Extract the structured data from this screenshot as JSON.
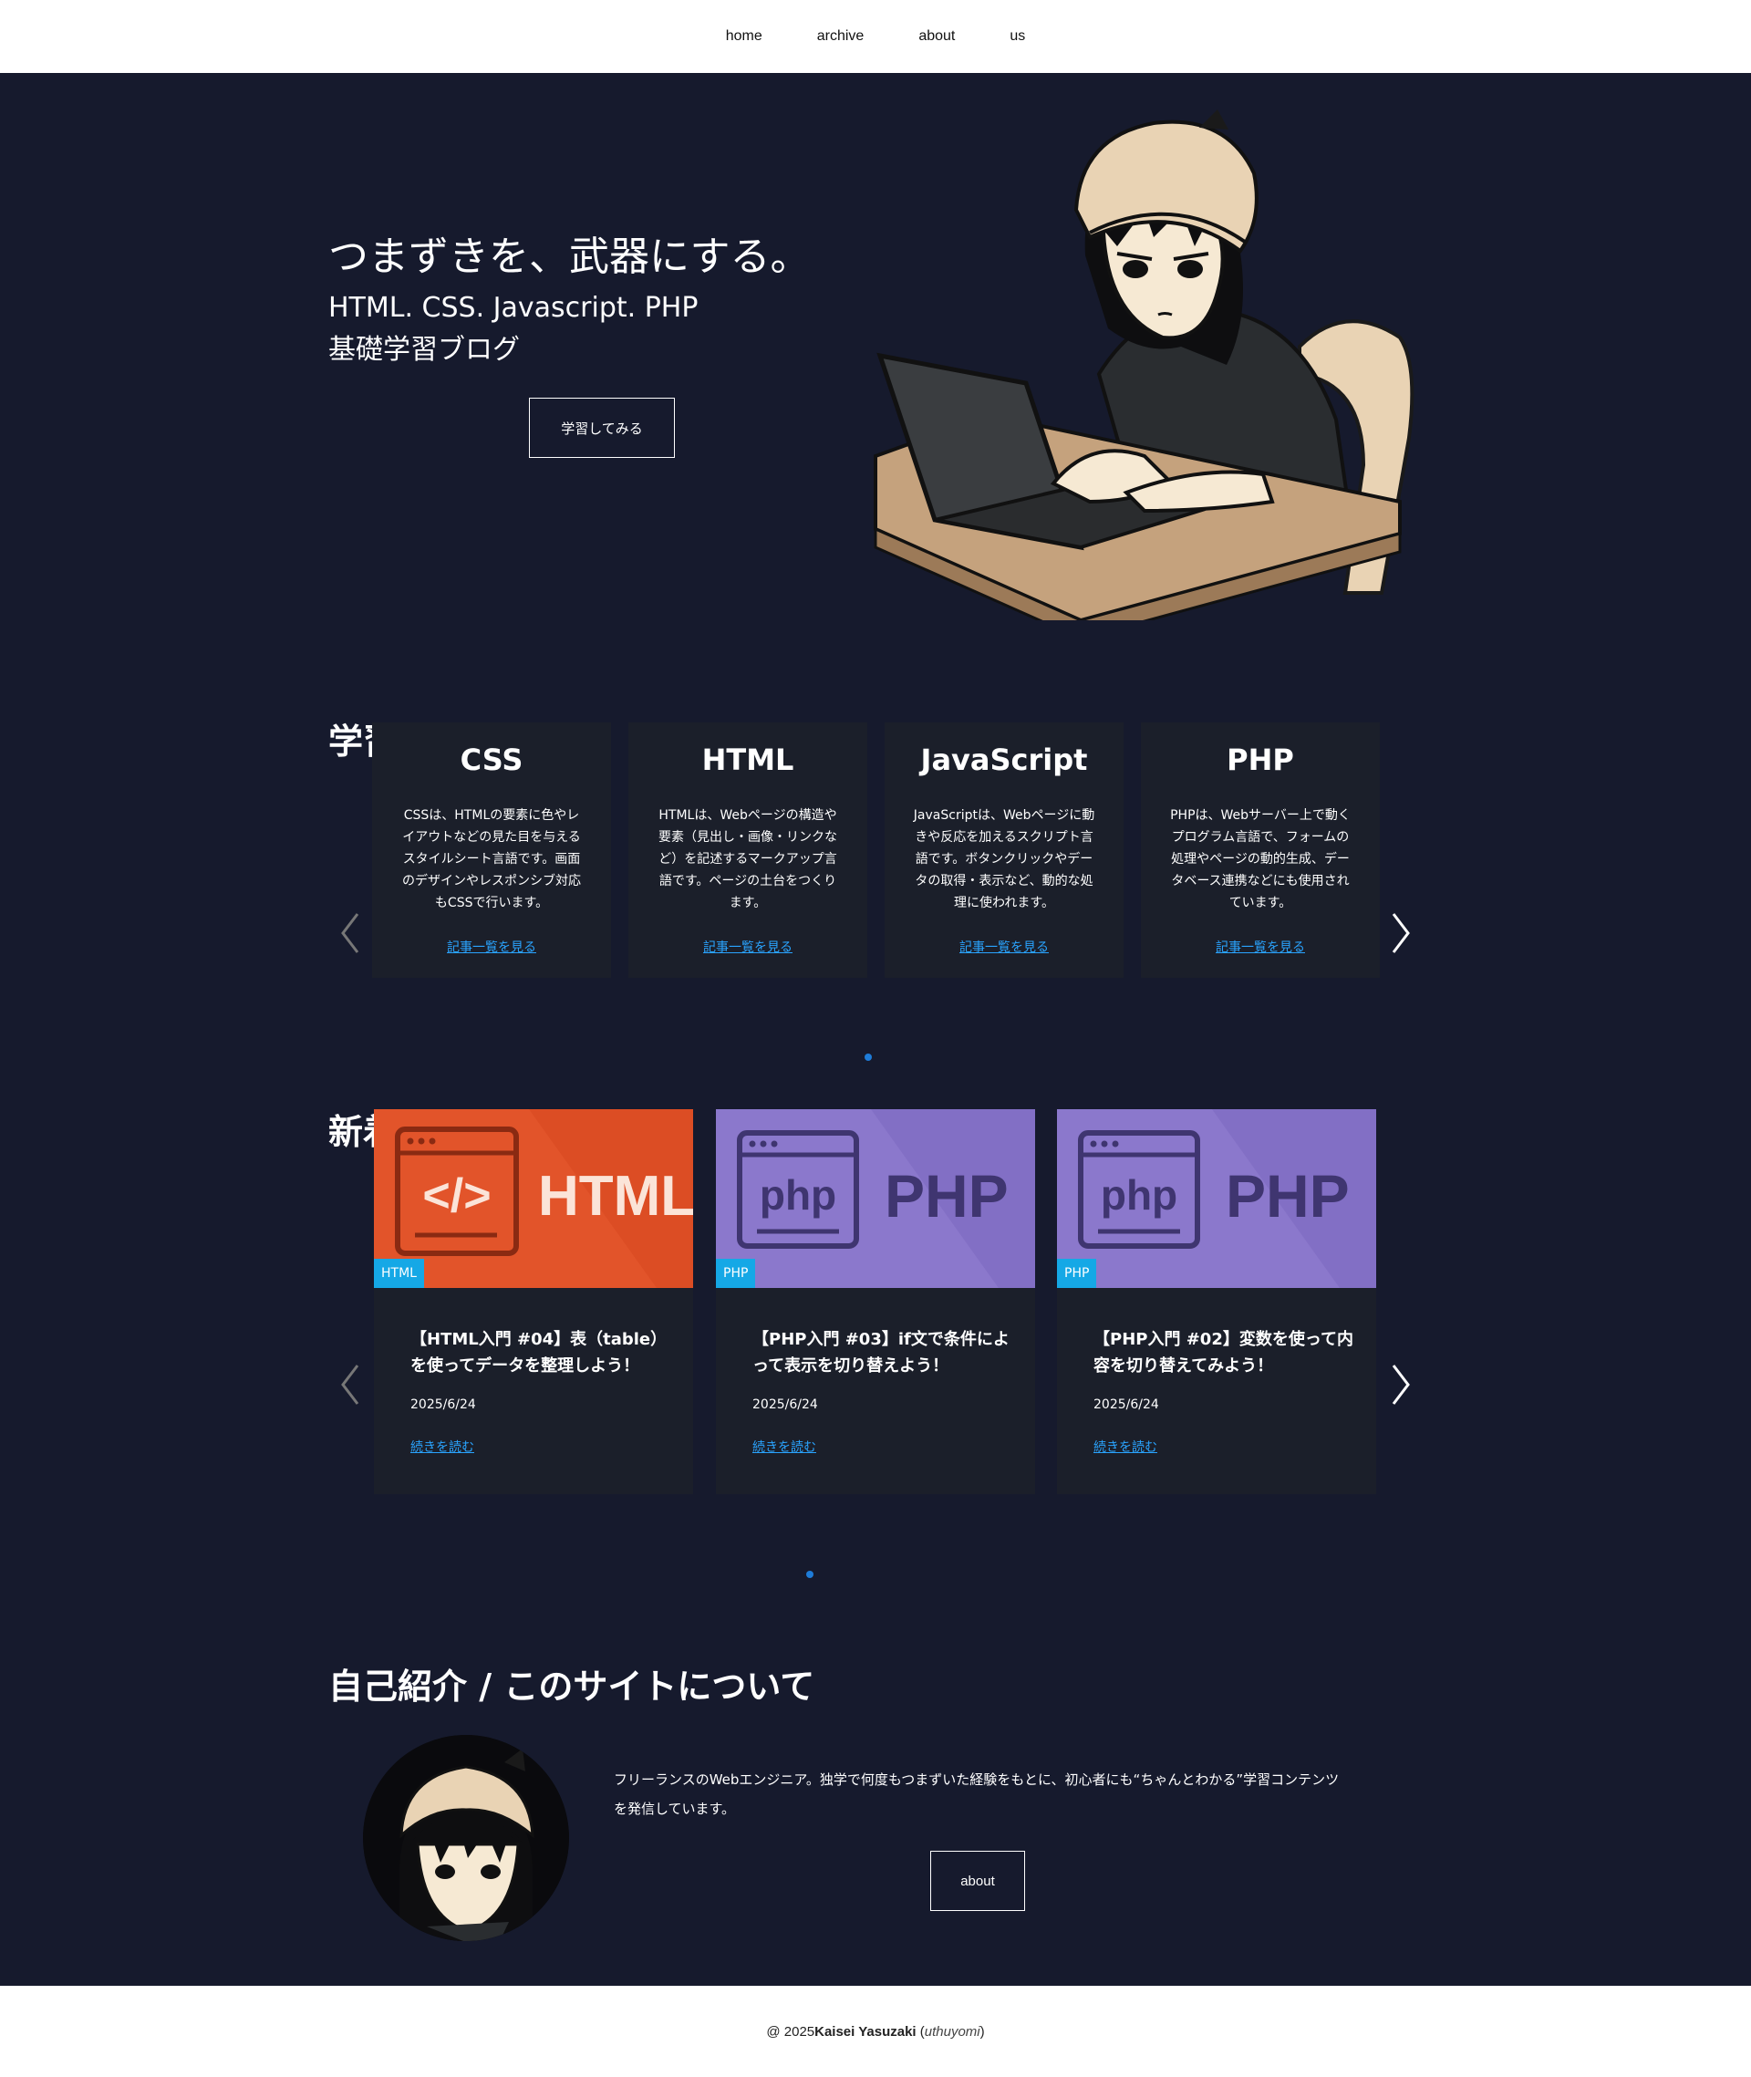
{
  "nav": {
    "items": [
      "home",
      "archive",
      "about",
      "us"
    ]
  },
  "hero": {
    "title": "つまずきを、武器にする。",
    "subtitle_line1": "HTML. CSS. Javascript. PHP",
    "subtitle_line2": "基礎学習ブログ",
    "cta": "学習してみる"
  },
  "categories": {
    "heading": "学習カテゴリ",
    "items": [
      {
        "title": "CSS",
        "desc": "CSSは、HTMLの要素に色やレイアウトなどの見た目を与えるスタイルシート言語です。画面のデザインやレスポンシブ対応もCSSで行います。",
        "link": "記事一覧を見る"
      },
      {
        "title": "HTML",
        "desc": "HTMLは、Webページの構造や要素（見出し・画像・リンクなど）を記述するマークアップ言語です。ページの土台をつくります。",
        "link": "記事一覧を見る"
      },
      {
        "title": "JavaScript",
        "desc": "JavaScriptは、Webページに動きや反応を加えるスクリプト言語です。ボタンクリックやデータの取得・表示など、動的な処理に使われます。",
        "link": "記事一覧を見る"
      },
      {
        "title": "PHP",
        "desc": "PHPは、Webサーバー上で動くプログラム言語で、フォームの処理やページの動的生成、データベース連携などにも使用されています。",
        "link": "記事一覧を見る"
      }
    ]
  },
  "articles": {
    "heading": "新着記事",
    "items": [
      {
        "thumb_label": "HTML",
        "thumb_code": "</>",
        "thumb_color": "#e2542a",
        "badge": "HTML",
        "title": "【HTML入門 #04】表（table）を使ってデータを整理しよう！",
        "date": "2025/6/24",
        "link": "続きを読む"
      },
      {
        "thumb_label": "PHP",
        "thumb_code": "php",
        "thumb_color": "#8b78cc",
        "badge": "PHP",
        "title": "【PHP入門 #03】if文で条件によって表示を切り替えよう！",
        "date": "2025/6/24",
        "link": "続きを読む"
      },
      {
        "thumb_label": "PHP",
        "thumb_code": "php",
        "thumb_color": "#8b78cc",
        "badge": "PHP",
        "title": "【PHP入門 #02】変数を使って内容を切り替えてみよう！",
        "date": "2025/6/24",
        "link": "続きを読む"
      }
    ]
  },
  "about": {
    "heading": "自己紹介 / このサイトについて",
    "text": "フリーランスのWebエンジニア。独学で何度もつまずいた経験をもとに、初心者にも“ちゃんとわかる”学習コンテンツを発信しています。",
    "button": "about"
  },
  "footer": {
    "prefix": "@ 2025",
    "name": "Kaisei Yasuzaki",
    "handle": "uthuyomi"
  },
  "colors": {
    "background": "#161a2d",
    "card": "#1b1f2a",
    "link": "#2aa4ff",
    "badge": "#15a8e6",
    "dot": "#1e7cd8"
  },
  "icons": [
    "chevron-left-icon",
    "chevron-right-icon",
    "code-window-icon"
  ]
}
